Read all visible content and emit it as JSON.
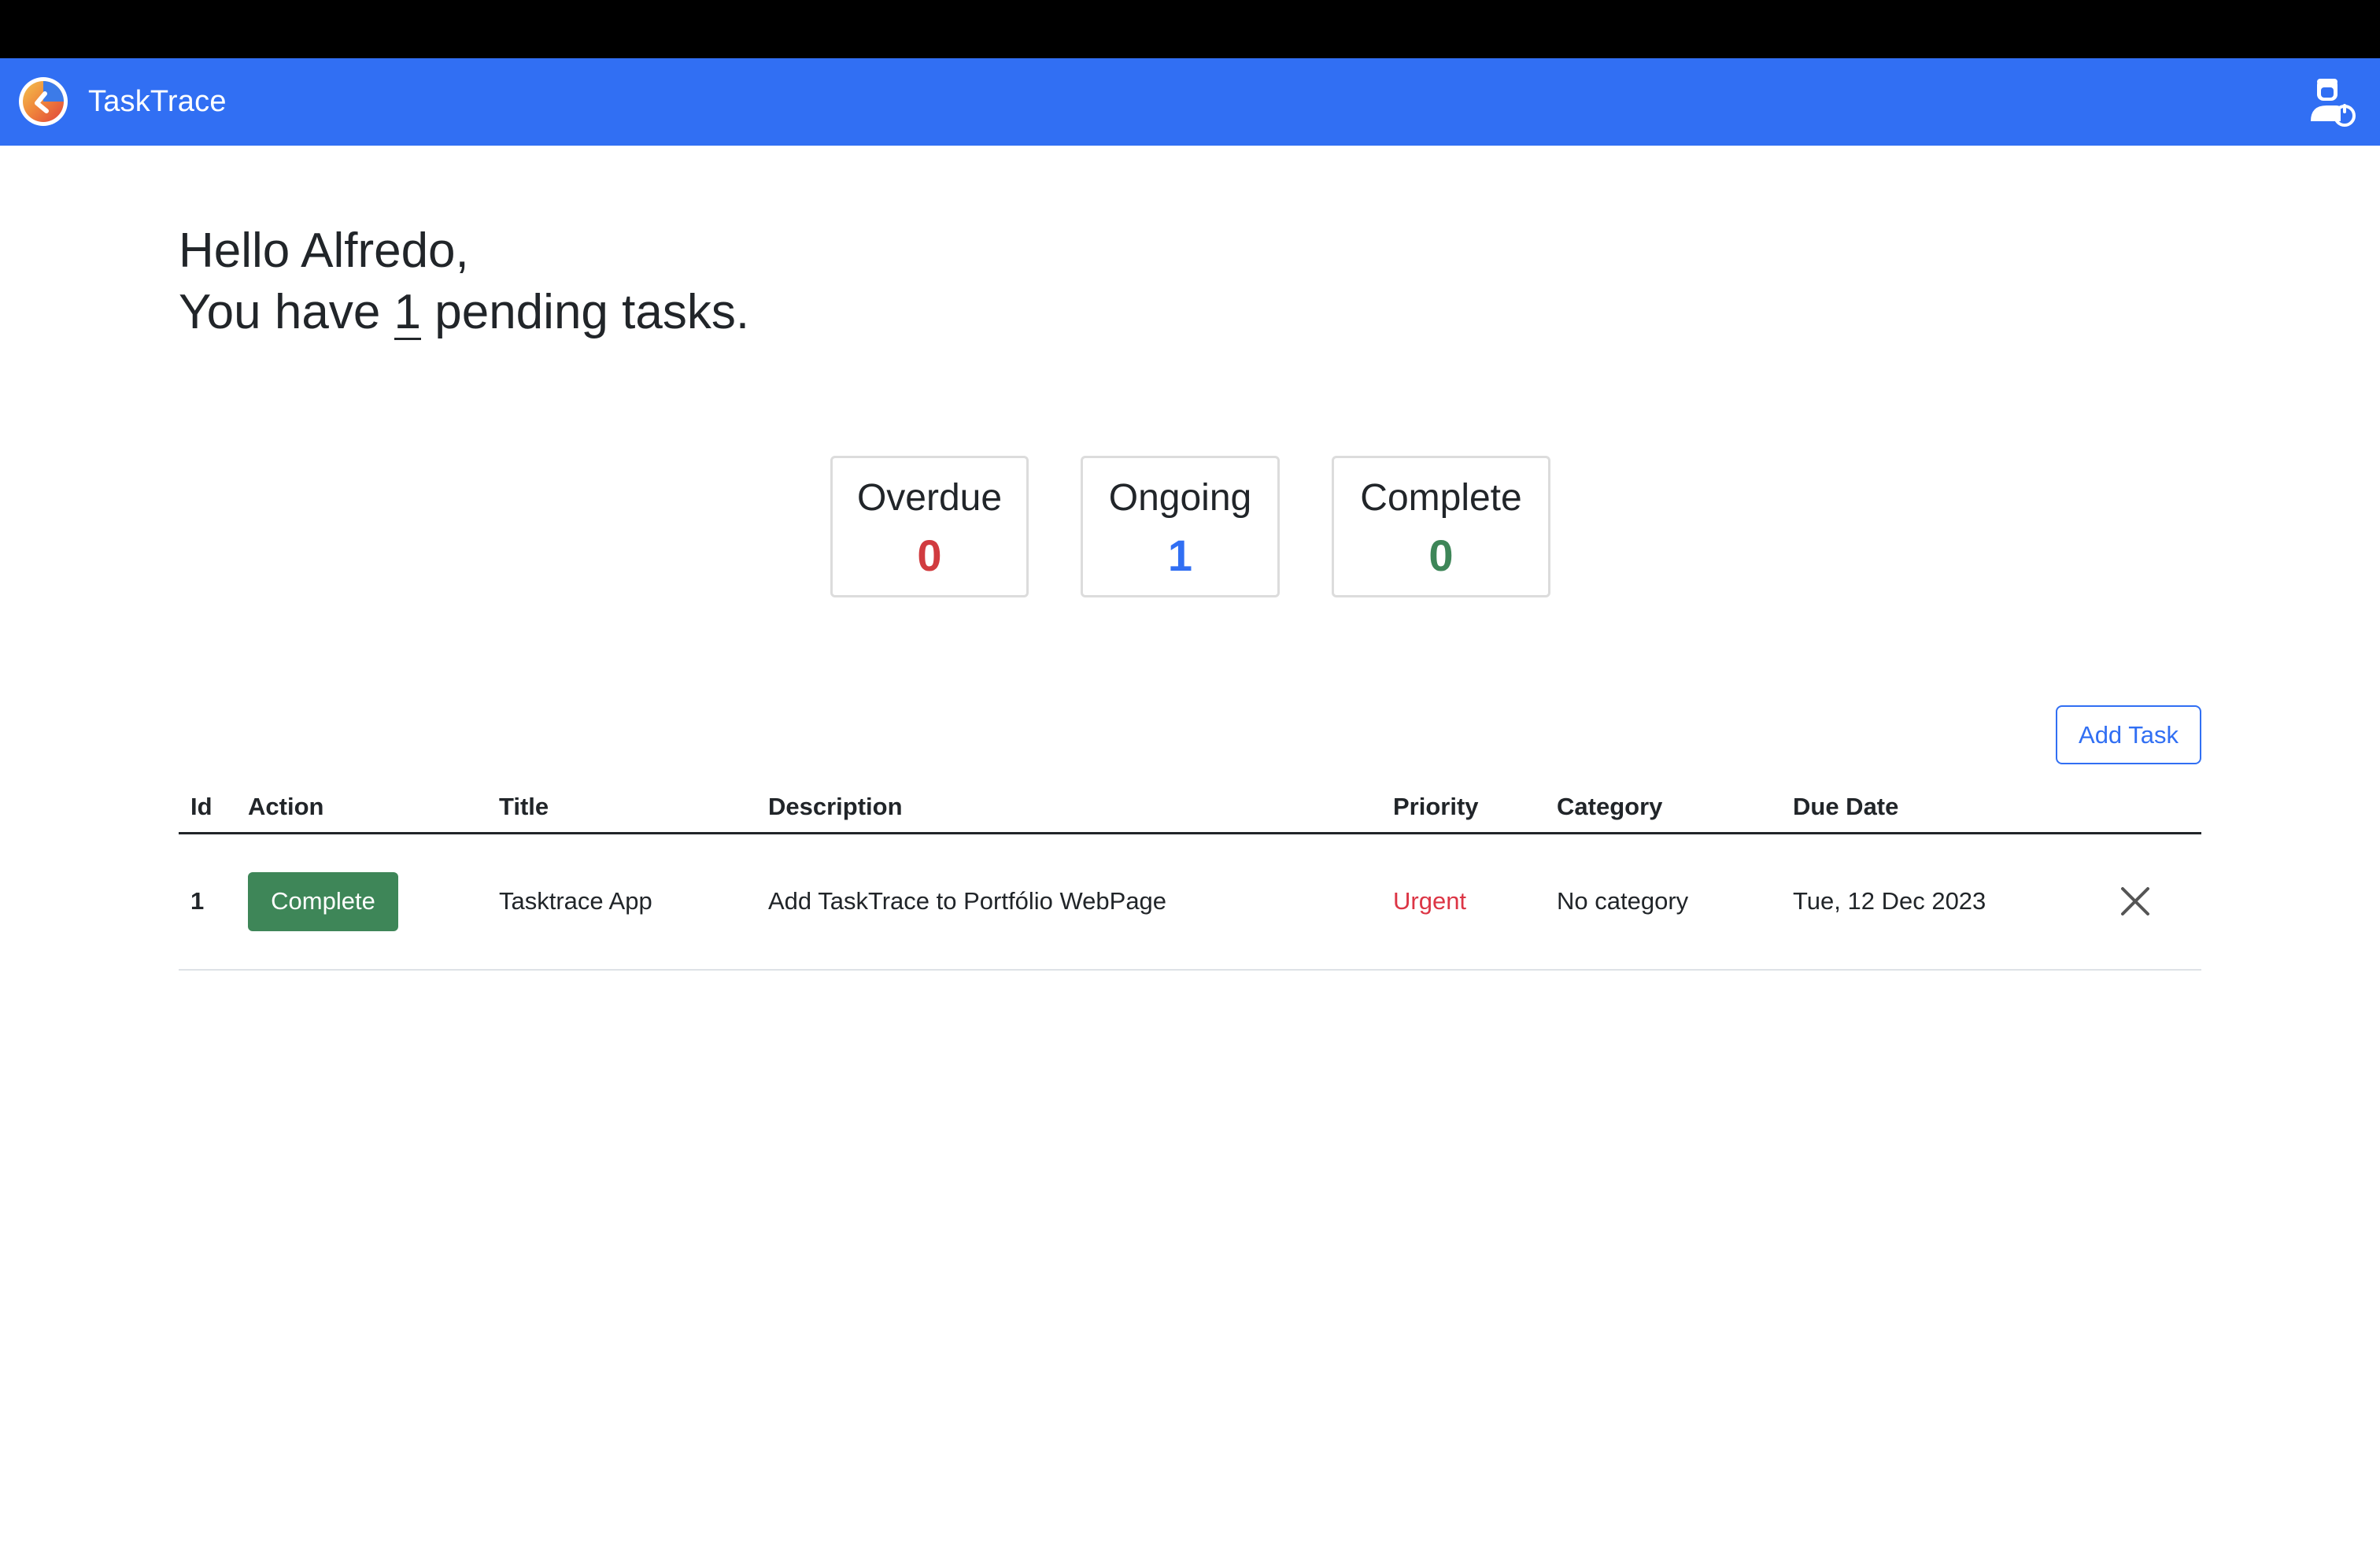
{
  "app": {
    "name": "TaskTrace",
    "logo_icon": "tasktrace-logo-icon",
    "user_icon": "user-logout-icon"
  },
  "colors": {
    "navbar": "#316ff3",
    "overdue": "#d13b3f",
    "ongoing": "#316ff3",
    "complete": "#3e8658",
    "urgent": "#dc3545"
  },
  "greeting": {
    "line1": "Hello Alfredo,",
    "prefix": "You have ",
    "count": "1",
    "suffix": " pending tasks."
  },
  "stats": [
    {
      "label": "Overdue",
      "value": "0"
    },
    {
      "label": "Ongoing",
      "value": "1"
    },
    {
      "label": "Complete",
      "value": "0"
    }
  ],
  "toolbar": {
    "add_task_label": "Add Task"
  },
  "table": {
    "headers": [
      "Id",
      "Action",
      "Title",
      "Description",
      "Priority",
      "Category",
      "Due Date"
    ],
    "rows": [
      {
        "id": "1",
        "action": "Complete",
        "title": "Tasktrace App",
        "description": "Add TaskTrace to Portfólio WebPage",
        "priority": "Urgent",
        "category": "No category",
        "due_date": "Tue, 12 Dec 2023",
        "delete_icon": "close-icon"
      }
    ]
  }
}
